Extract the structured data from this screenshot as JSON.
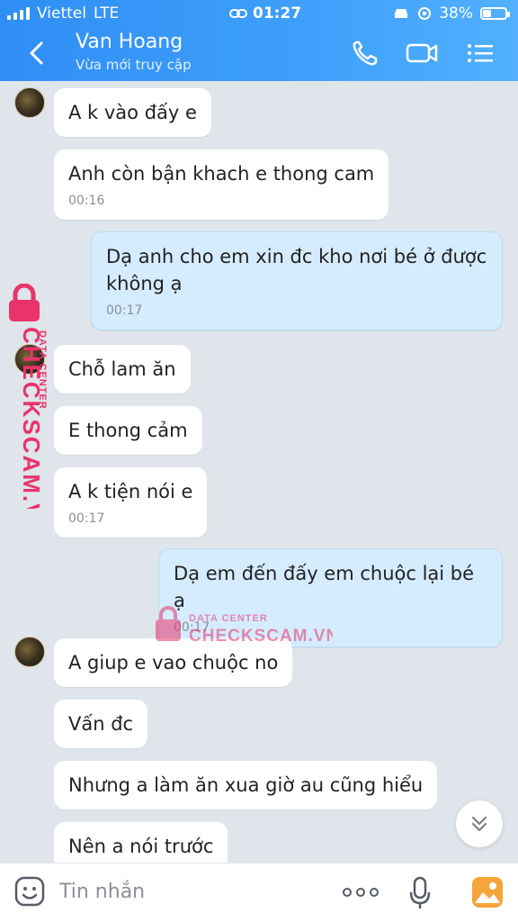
{
  "status_bar": {
    "carrier": "Viettel",
    "network": "LTE",
    "time": "01:27",
    "battery": "38%",
    "battery_level": 0.38
  },
  "header": {
    "contact_name": "Van Hoang",
    "contact_status": "Vừa mới truy cập"
  },
  "messages": [
    {
      "from": "them",
      "text": "A k vào đấy e",
      "time": ""
    },
    {
      "from": "them",
      "text": "Anh còn bận khach e thong cam",
      "time": "00:16"
    },
    {
      "from": "me",
      "text": "Dạ anh cho em xin đc kho nơi bé ở được không ạ",
      "time": "00:17"
    },
    {
      "from": "them",
      "text": "Chỗ lam ăn",
      "time": ""
    },
    {
      "from": "them",
      "text": "E thong cảm",
      "time": ""
    },
    {
      "from": "them",
      "text": "A k tiện nói e",
      "time": "00:17"
    },
    {
      "from": "me",
      "text": "Dạ em đến đấy em chuộc lại bé ạ",
      "time": "00:17"
    },
    {
      "from": "them",
      "text": "A giup e vao chuộc no",
      "time": ""
    },
    {
      "from": "them",
      "text": "Vấn đc",
      "time": ""
    },
    {
      "from": "them",
      "text": "Nhưng a làm ăn xua giờ au cũng hiểu",
      "time": ""
    },
    {
      "from": "them",
      "text": "Nên a nói trước",
      "time": ""
    }
  ],
  "watermark": {
    "top_text": "DATA CENTER",
    "brand": "CHECKSCAM.VN",
    "color": "#e8336b"
  },
  "input_bar": {
    "placeholder": "Tin nhắn"
  },
  "colors": {
    "header": "#3a9af8",
    "my_bubble": "#d5ecfe",
    "their_bubble": "#ffffff",
    "background": "#dfe5ea"
  }
}
